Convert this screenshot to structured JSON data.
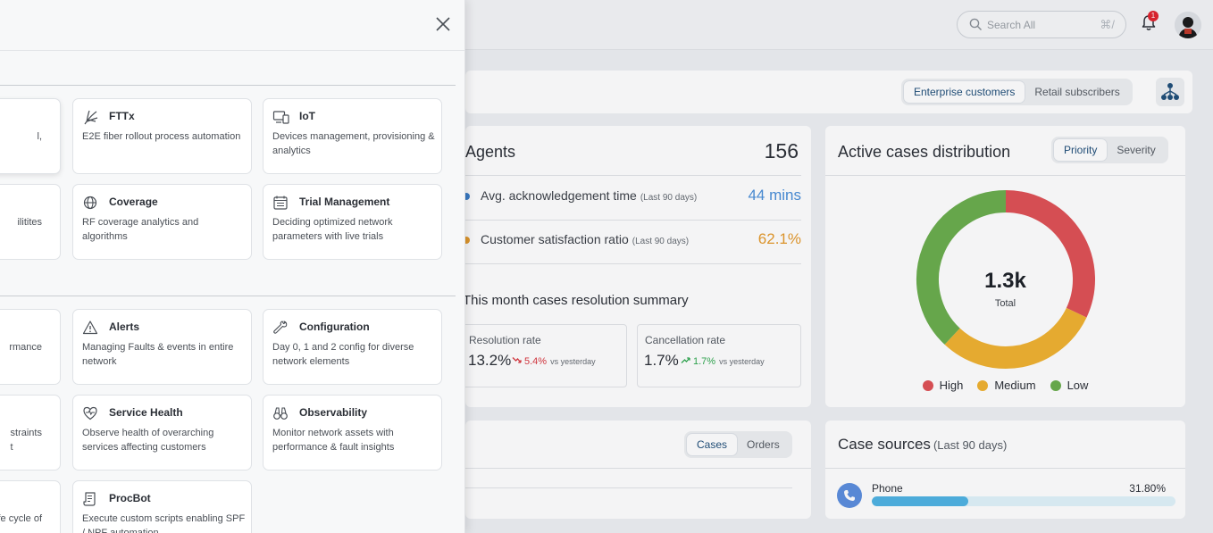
{
  "header": {
    "search_placeholder": "Search All",
    "search_shortcut": "⌘/",
    "notifications_count": "1"
  },
  "customer_toggle": {
    "options": [
      "Enterprise customers",
      "Retail subscribers"
    ],
    "selected": "Enterprise customers"
  },
  "agents": {
    "title": "Agents",
    "count": "156",
    "metrics": [
      {
        "label": "Avg. acknowledgement time",
        "period": "(Last 90 days)",
        "value": "44 mins",
        "color": "#4a8fd9",
        "dot_color": "#3a7ec9"
      },
      {
        "label": "Customer satisfaction ratio",
        "period": "(Last 90 days)",
        "value": "62.1%",
        "color": "#e59a2c",
        "dot_color": "#e59a2c"
      }
    ],
    "summary_title": "This month cases resolution summary",
    "resolution": {
      "label": "Resolution rate",
      "value": "13.2%",
      "change": "5.4%",
      "vs": "vs yesterday",
      "direction": "down",
      "color": "#d9363e"
    },
    "cancellation": {
      "label": "Cancellation rate",
      "value": "1.7%",
      "change": "1.7%",
      "vs": "vs yesterday",
      "direction": "up",
      "color": "#2fa84f"
    }
  },
  "distribution": {
    "title": "Active cases distribution",
    "toggle": [
      "Priority",
      "Severity"
    ],
    "selected": "Priority",
    "total_value": "1.3k",
    "total_label": "Total"
  },
  "chart_data": {
    "type": "pie",
    "donut": true,
    "categories": [
      "High",
      "Medium",
      "Low"
    ],
    "values": [
      32,
      30,
      38
    ],
    "colors": [
      "#df5155",
      "#f0b230",
      "#6aad4c"
    ]
  },
  "cases_card": {
    "toggle": [
      "Cases",
      "Orders"
    ],
    "selected": "Cases"
  },
  "sources": {
    "title": "Case sources",
    "period": "(Last 90 days)",
    "items": [
      {
        "label": "Phone",
        "percent_text": "31.80%",
        "fraction": 0.318
      }
    ]
  },
  "panel": {
    "tiles": [
      {
        "name": "FTTx",
        "desc": "E2E fiber rollout process automation",
        "icon": "fiber-icon"
      },
      {
        "name": "IoT",
        "desc": "Devices management, provisioning & analytics",
        "icon": "devices-icon"
      },
      {
        "name": "Coverage",
        "desc": "RF coverage analytics and algorithms",
        "icon": "globe-icon"
      },
      {
        "name": "Trial Management",
        "desc": "Deciding optimized network parameters with live trials",
        "icon": "calendar-icon"
      },
      {
        "name": "Alerts",
        "desc": "Managing Faults & events in entire network",
        "icon": "warning-icon"
      },
      {
        "name": "Configuration",
        "desc": "Day 0, 1 and 2 config for diverse network elements",
        "icon": "wrench-icon"
      },
      {
        "name": "Service Health",
        "desc": "Observe health of overarching services affecting customers",
        "icon": "heart-pulse-icon"
      },
      {
        "name": "Observability",
        "desc": "Monitor network assets with performance & fault insights",
        "icon": "binoculars-icon"
      },
      {
        "name": "ProcBot",
        "desc": "Execute custom scripts enabling SPF / NPF automation",
        "icon": "script-icon"
      }
    ],
    "partial_tiles": [
      {
        "text": "l,"
      },
      {
        "text": "ilitites"
      },
      {
        "text": "rmance"
      },
      {
        "text": "straints\nt"
      },
      {
        "text": "ife cycle of"
      }
    ]
  }
}
